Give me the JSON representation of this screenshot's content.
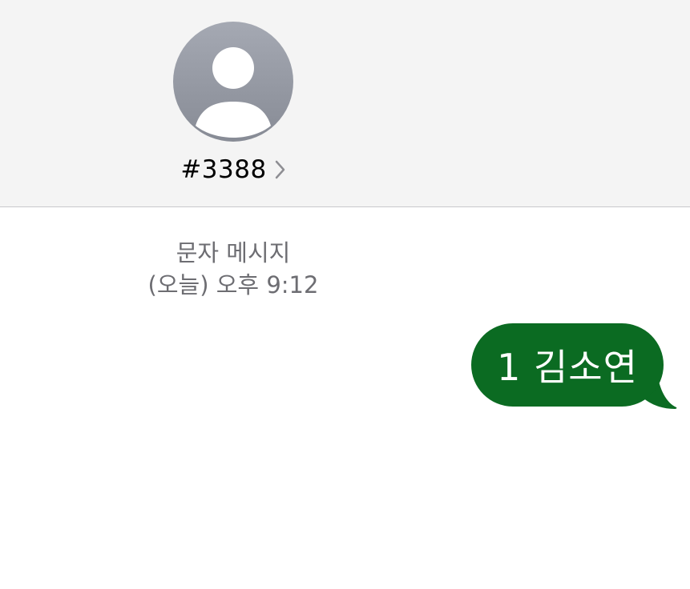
{
  "header": {
    "contact_name": "#3388",
    "avatar_icon": "person-silhouette-icon",
    "chevron_icon": "chevron-right-icon"
  },
  "thread": {
    "service_label": "문자 메시지",
    "timestamp": "(오늘) 오후 9:12"
  },
  "messages": [
    {
      "direction": "outgoing",
      "text": "1 김소연"
    }
  ],
  "colors": {
    "header_bg": "#f4f4f4",
    "bubble_bg": "#0b6b22",
    "bubble_text": "#ffffff",
    "meta_text": "#6d6d72"
  }
}
